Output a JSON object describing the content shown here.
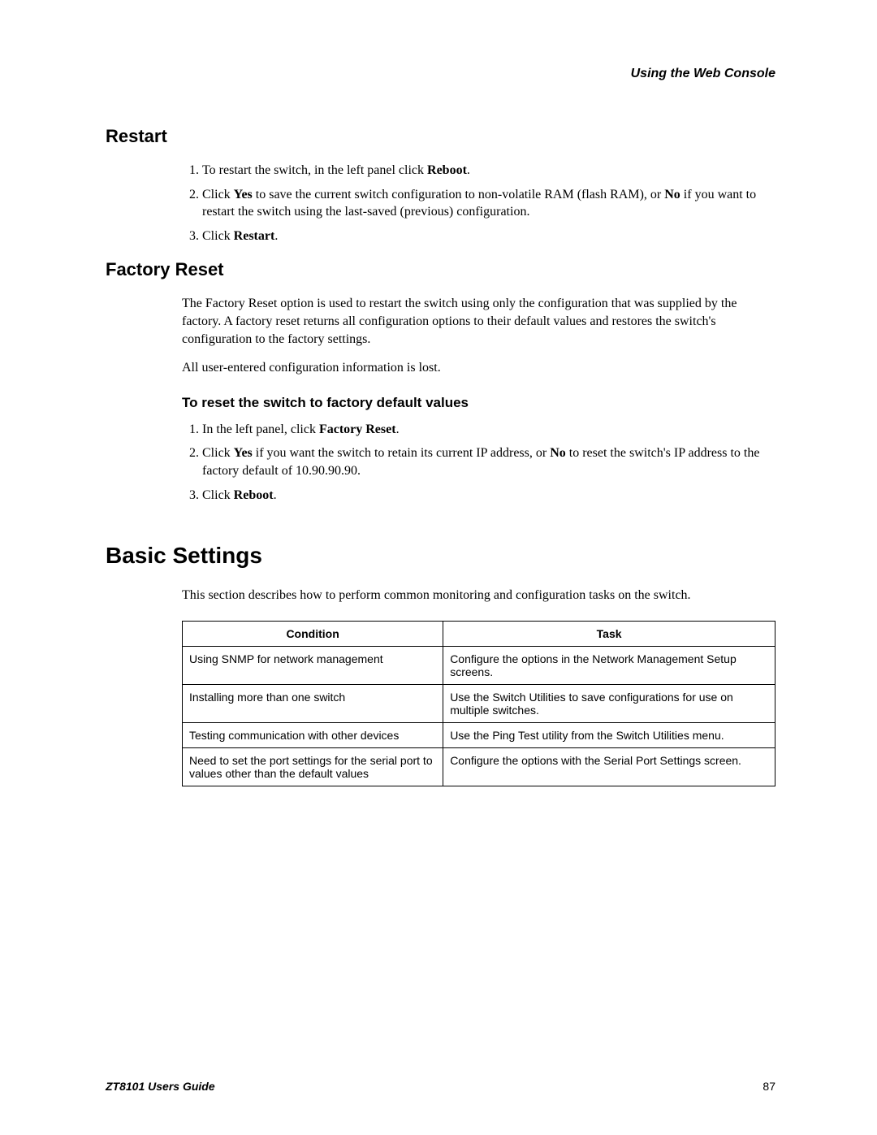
{
  "header": {
    "right": "Using the Web Console"
  },
  "restart": {
    "title": "Restart",
    "steps": {
      "s1a": "To restart the switch, in the left panel click ",
      "s1b": "Reboot",
      "s1c": ".",
      "s2a": "Click ",
      "s2b": "Yes",
      "s2c": " to save the current switch configuration to non-volatile RAM (flash RAM), or ",
      "s2d": "No",
      "s2e": " if you want to restart the switch using the last-saved (previous) configuration.",
      "s3a": "Click ",
      "s3b": "Restart",
      "s3c": "."
    }
  },
  "factory": {
    "title": "Factory Reset",
    "p1": "The Factory Reset option is used to restart the switch using only the configuration that was supplied by the factory. A factory reset returns all configuration options to their default values and restores the switch's configuration to the factory settings.",
    "p2": "All user-entered configuration information is lost.",
    "sub": "To reset the switch to factory default values",
    "steps": {
      "s1a": "In the left panel, click ",
      "s1b": "Factory Reset",
      "s1c": ".",
      "s2a": "Click ",
      "s2b": "Yes",
      "s2c": " if you want the switch to retain its current IP address, or ",
      "s2d": "No",
      "s2e": " to reset the switch's IP address to the factory default of 10.90.90.90.",
      "s3a": "Click ",
      "s3b": "Reboot",
      "s3c": "."
    }
  },
  "basic": {
    "title": "Basic Settings",
    "intro": "This section describes how to perform common monitoring and configuration tasks on the switch.",
    "table": {
      "h1": "Condition",
      "h2": "Task",
      "r1c1": "Using SNMP for network management",
      "r1c2": "Configure the options in the Network Management Setup screens.",
      "r2c1": "Installing more than one switch",
      "r2c2": "Use the Switch Utilities to save configurations for use on multiple switches.",
      "r3c1": "Testing communication with other devices",
      "r3c2": "Use the Ping Test utility from the Switch Utilities menu.",
      "r4c1": "Need to set the port settings for the serial port to values other than the default values",
      "r4c2": "Configure the options with the Serial Port Settings screen."
    }
  },
  "footer": {
    "guide": "ZT8101 Users Guide",
    "page": "87"
  }
}
